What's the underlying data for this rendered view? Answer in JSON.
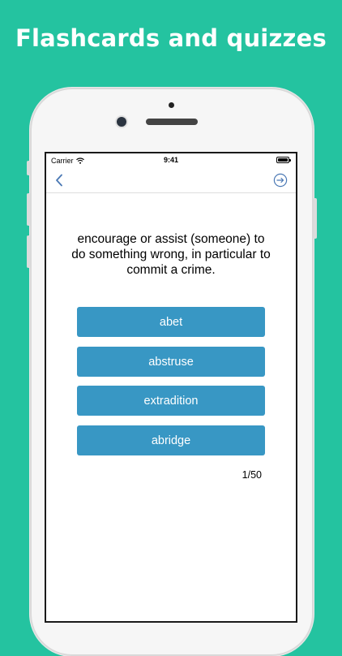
{
  "headline": "Flashcards and quizzes",
  "status_bar": {
    "carrier": "Carrier",
    "time": "9:41",
    "wifi_icon": "wifi-icon",
    "battery_icon": "battery-icon",
    "battery_level": 1.0
  },
  "nav": {
    "back_icon": "chevron-left-icon",
    "forward_icon": "arrow-circle-right-icon",
    "accent_color": "#4a78b4"
  },
  "quiz": {
    "definition": "encourage or assist (someone) to do something wrong, in particular to commit a crime.",
    "options": [
      "abet",
      "abstruse",
      "extradition",
      "abridge"
    ],
    "progress": "1/50",
    "button_color": "#3897c4"
  },
  "colors": {
    "background": "#24c3a0",
    "headline_text": "#ffffff"
  }
}
